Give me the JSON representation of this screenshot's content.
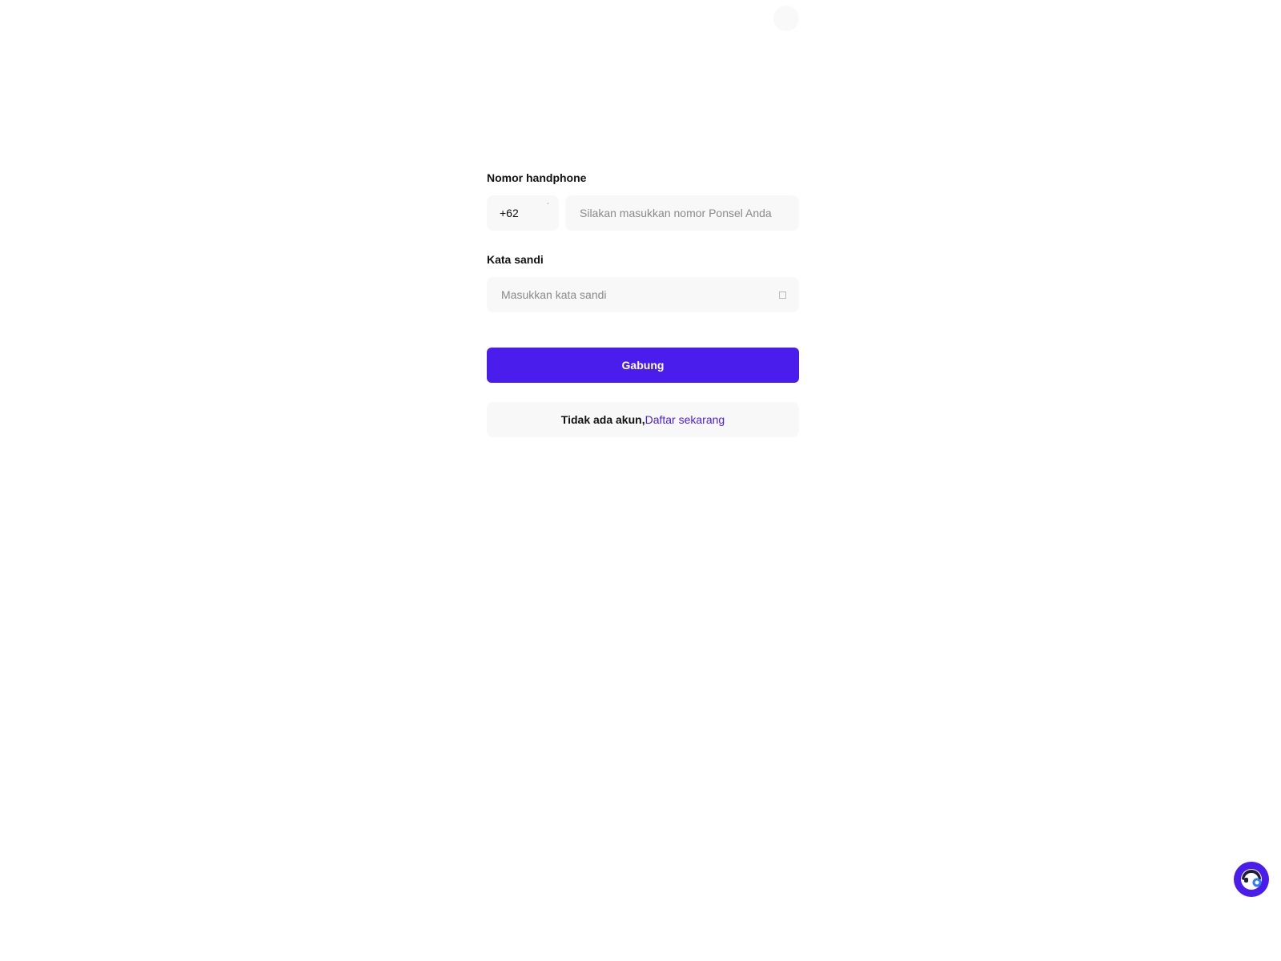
{
  "form": {
    "phone": {
      "label": "Nomor handphone",
      "country_code": "+62",
      "placeholder": "Silakan masukkan nomor Ponsel Anda",
      "value": ""
    },
    "password": {
      "label": "Kata sandi",
      "placeholder": "Masukkan kata sandi",
      "value": ""
    },
    "submit_label": "Gabung",
    "register": {
      "prompt": "Tidak ada akun,",
      "link_label": "Daftar sekarang"
    }
  },
  "colors": {
    "accent": "#4a1ded",
    "field_bg": "#f8f8f8",
    "text": "#111111",
    "placeholder": "#8a8a8a"
  },
  "icons": {
    "country_dropdown": "chevron-down-icon",
    "password_toggle": "eye-icon",
    "support": "customer-service-icon"
  }
}
